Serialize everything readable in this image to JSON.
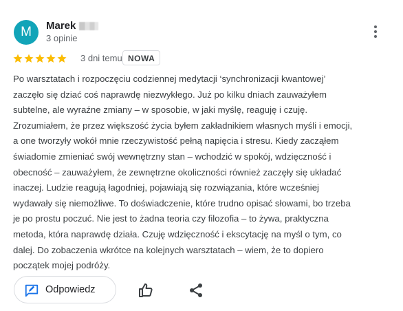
{
  "review": {
    "author": {
      "initial": "M",
      "name": "Marek",
      "review_count": "3 opinie",
      "avatar_color": "#12a4b8"
    },
    "rating": 5,
    "rating_max": 5,
    "star_color": "#fbbc04",
    "date": "3 dni temu",
    "badge": "NOWA",
    "text": "Po warsztatach i rozpoczęciu codziennej medytacji ‘synchronizacji kwantowej’ zaczęło się dziać coś naprawdę niezwykłego. Już po kilku dniach zauważyłem subtelne, ale wyraźne zmiany – w sposobie, w jaki myślę, reaguję i czuję. Zrozumiałem, że przez większość życia byłem zakładnikiem własnych myśli i emocji, a one tworzyły wokół mnie rzeczywistość pełną napięcia i stresu. Kiedy zacząłem świadomie zmieniać swój wewnętrzny stan – wchodzić w spokój, wdzięczność i obecność – zauważyłem, że zewnętrzne okoliczności również zaczęły się układać inaczej. Ludzie reagują łagodniej, pojawiają się rozwiązania, które wcześniej wydawały się niemożliwe. To doświadczenie, które trudno opisać słowami, bo trzeba je po prostu poczuć. Nie jest to żadna teoria czy filozofia – to żywa, praktyczna metoda, która naprawdę działa. Czuję wdzięczność i ekscytację na myśl o tym, co dalej. Do zobaczenia wkrótce na kolejnych warsztatach – wiem, że to dopiero początek mojej podróży."
  },
  "actions": {
    "reply_label": "Odpowiedz",
    "reply_icon": "reply-edit-icon",
    "like_icon": "thumb-up-icon",
    "share_icon": "share-icon",
    "menu_icon": "more-vert-icon",
    "reply_icon_color": "#1a73e8"
  }
}
